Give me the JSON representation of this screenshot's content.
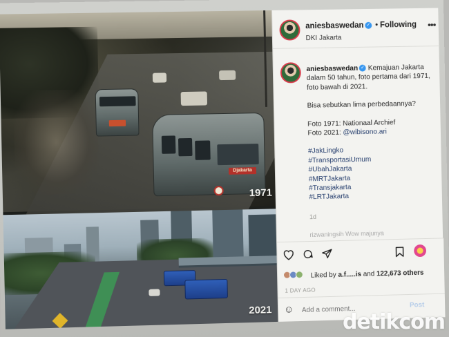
{
  "post": {
    "username": "aniesbaswedan",
    "verified_mark": "✓",
    "follow_state": "Following",
    "location": "DKI Jakarta",
    "more_icon": "•••",
    "photo_top_year": "1971",
    "photo_bottom_year": "2021",
    "bus_plate_top": "Djakarta",
    "caption": {
      "line1": "Kemajuan Jakarta dalam 50 tahun, foto pertama dari 1971, foto bawah di 2021.",
      "line2": "Bisa sebutkan lima perbedaannya?",
      "credit1": "Foto 1971: Nationaal Archief",
      "credit2_prefix": "Foto 2021: ",
      "credit2_mention": "@wibisono.ari"
    },
    "hashtags": [
      "#JakLingko",
      "#TransportasiUmum",
      "#UbahJakarta",
      "#MRTJakarta",
      "#Transjakarta",
      "#LRTJakarta"
    ],
    "age": "1d",
    "next_comment_preview": "rizwaningsih   Wow majunya"
  },
  "actions": {
    "liked_prefix": "Liked by ",
    "liked_user": "a.f.....is",
    "liked_and": " and ",
    "liked_count": "122,673 others",
    "time": "1 DAY AGO",
    "comment_placeholder": "Add a comment...",
    "post_label": "Post"
  },
  "watermark": {
    "brand": "detikcom"
  },
  "colors": {
    "accent_blue": "#3897f0",
    "hashtag": "#28406f",
    "bus_plate": "#b3312a",
    "transjakarta": "#2f5fb8"
  }
}
